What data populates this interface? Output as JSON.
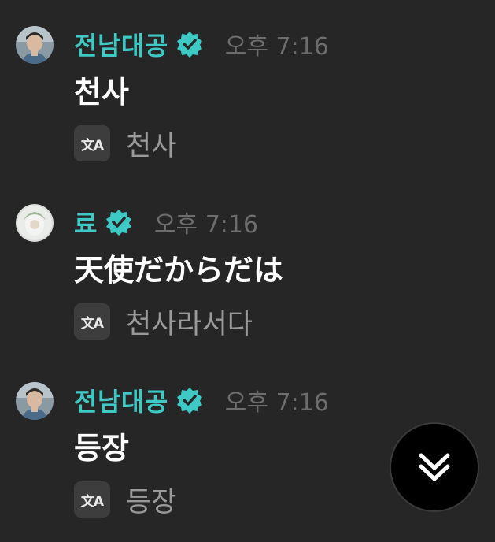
{
  "messages": [
    {
      "username": "전남대공",
      "verified": true,
      "time": "오후 7:16",
      "text": "천사",
      "translation": "천사",
      "avatar_icon": "profile-photo-man"
    },
    {
      "username": "료",
      "verified": true,
      "time": "오후 7:16",
      "text": "天使だからだは",
      "translation": "천사라서다",
      "avatar_icon": "profile-photo-light"
    },
    {
      "username": "전남대공",
      "verified": true,
      "time": "오후 7:16",
      "text": "등장",
      "translation": "등장",
      "avatar_icon": "profile-photo-man"
    }
  ],
  "translate_icon_label": "文A",
  "colors": {
    "background": "#262626",
    "username": "#3ec9c4",
    "verified_badge": "#3ec9c4",
    "timestamp": "#6d6d6d",
    "translation_text": "#9a9a9a"
  },
  "scroll_button_icon": "double-chevron-down-icon"
}
